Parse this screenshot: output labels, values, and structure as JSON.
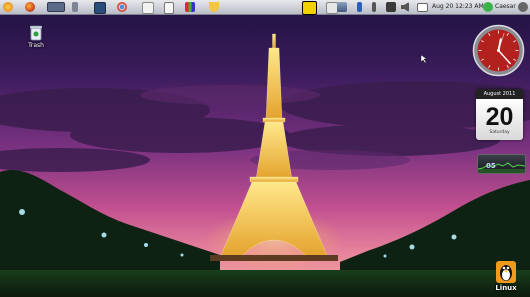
{
  "top_panel": {
    "clock": "Aug 20 12:23 AM",
    "user_name": "Caesar",
    "launchers": [
      "menu-icon",
      "firefox-icon",
      "show-desktop-icon",
      "file-cabinet-icon",
      "terminal-icon",
      "chrome-icon",
      "text-editor-icon",
      "document-icon",
      "system-monitor-icon",
      "basket-icon"
    ],
    "tray": [
      "ubuntu-one-icon",
      "network-icon",
      "bluetooth-icon",
      "battery-icon",
      "screenshot-icon",
      "volume-icon",
      "mail-icon",
      "user-status-icon",
      "power-icon"
    ]
  },
  "desktop": {
    "trash_label": "Trash",
    "linux_label": "Linux"
  },
  "calendar_widget": {
    "month_year": "August 2011",
    "day": "20",
    "weekday": "Saturday"
  },
  "monitor_widget": {
    "value": "05"
  },
  "clock_widget": {
    "hour": 12,
    "minute": 23,
    "second": 3
  },
  "colors": {
    "panel": "#d4d6de",
    "sky_top": "#26124a",
    "sky_mid": "#c24f8e",
    "clock_red": "#b3211e"
  }
}
